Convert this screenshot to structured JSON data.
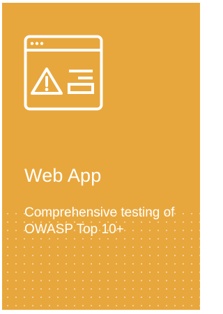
{
  "card": {
    "title": "Web App",
    "description": "Comprehensive testing of OWASP Top 10+",
    "icon": "browser-warning-icon",
    "background_color": "#e8a73c",
    "text_color": "#ffffff"
  }
}
